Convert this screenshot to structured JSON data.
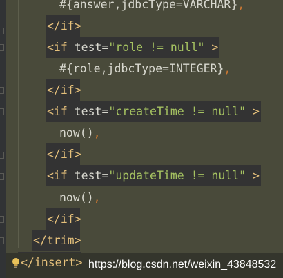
{
  "code_lines": [
    {
      "prefix": "#{answer,jdbcType=VARCHAR}",
      "suffix": ","
    },
    {
      "tag": "</if>"
    },
    {
      "open": "<if",
      "attr": " test=",
      "value": "\"role != null\"",
      "close": " >"
    },
    {
      "prefix": "#{role,jdbcType=INTEGER}",
      "suffix": ","
    },
    {
      "tag": "</if>"
    },
    {
      "open": "<if",
      "attr": " test=",
      "value": "\"createTime != null\"",
      "close": " >"
    },
    {
      "prefix": "now()",
      "suffix": ","
    },
    {
      "tag": "</if>"
    },
    {
      "open": "<if",
      "attr": " test=",
      "value": "\"updateTime != null\"",
      "close": " >"
    },
    {
      "prefix": "now()",
      "suffix": ","
    },
    {
      "tag": "</if>"
    },
    {
      "tag": "</trim>"
    },
    {
      "tag": "</insert>"
    }
  ],
  "watermark": "https://blog.csdn.net/weixin_43848532",
  "colors": {
    "editor_bg": "#494a3a",
    "highlight_bg": "#333333",
    "tag": "#e5c07b",
    "string": "#a5c261",
    "punctuation": "#cc7832",
    "text": "#d8d8cf"
  },
  "icons": [
    "lightbulb-icon"
  ]
}
